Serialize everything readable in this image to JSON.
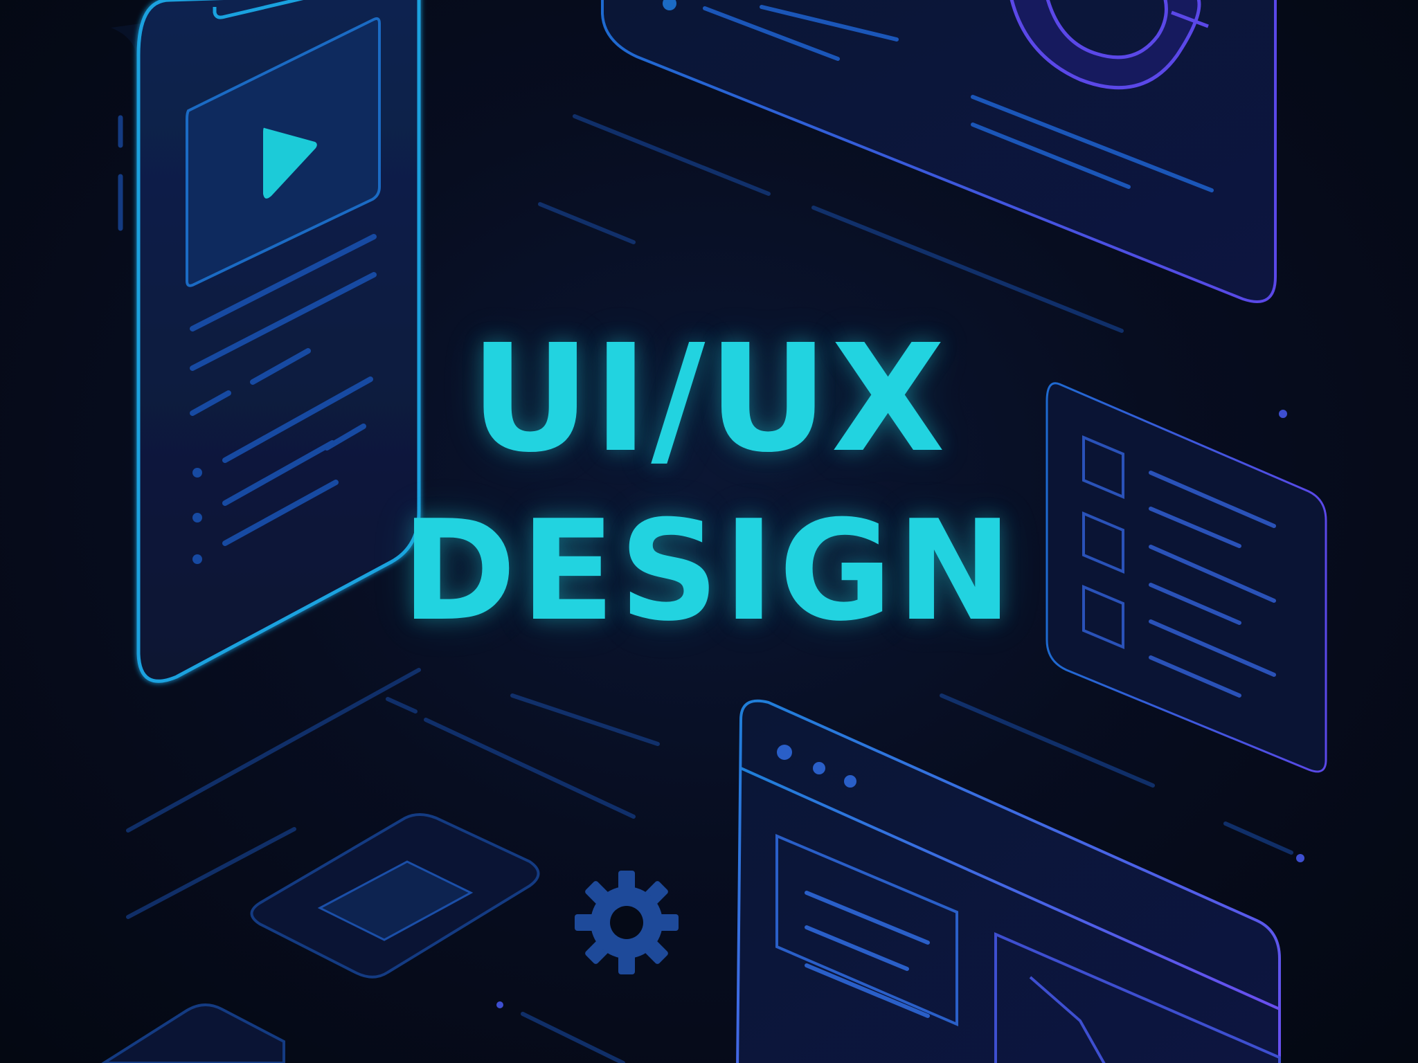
{
  "headline": {
    "line1": "UI/UX",
    "line2": "DESIGN"
  },
  "colors": {
    "background": "#050a17",
    "accent_cyan": "#22d3e0",
    "line_blue": "#1d4fa8",
    "accent_violet": "#6a4ef0"
  },
  "icons": [
    "play-icon",
    "gear-icon",
    "donut-chart-icon",
    "checkbox-icon",
    "window-dots-icon",
    "image-placeholder-icon"
  ]
}
